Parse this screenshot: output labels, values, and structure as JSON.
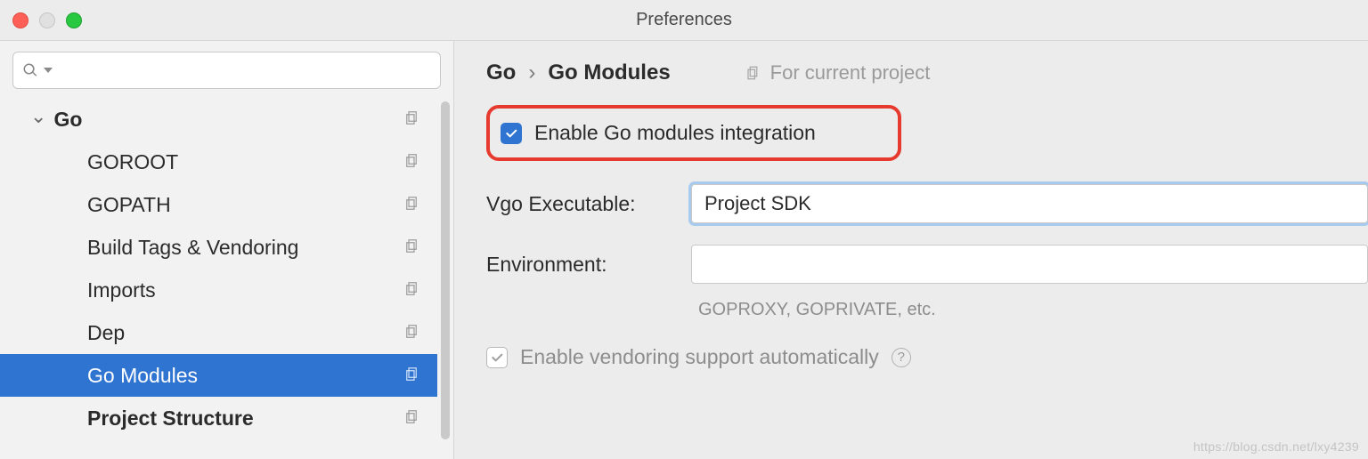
{
  "window": {
    "title": "Preferences"
  },
  "sidebar": {
    "search_placeholder": "",
    "items": [
      {
        "label": "Go",
        "kind": "root",
        "has_copy": true
      },
      {
        "label": "GOROOT",
        "kind": "child",
        "has_copy": true
      },
      {
        "label": "GOPATH",
        "kind": "child",
        "has_copy": true
      },
      {
        "label": "Build Tags & Vendoring",
        "kind": "child",
        "has_copy": true
      },
      {
        "label": "Imports",
        "kind": "child",
        "has_copy": true
      },
      {
        "label": "Dep",
        "kind": "child",
        "has_copy": true
      },
      {
        "label": "Go Modules",
        "kind": "child",
        "has_copy": true,
        "selected": true
      },
      {
        "label": "Project Structure",
        "kind": "bold",
        "has_copy": true
      }
    ]
  },
  "breadcrumbs": {
    "parts": [
      "Go",
      "Go Modules"
    ],
    "for_current_project": "For current project"
  },
  "form": {
    "enable_modules_label": "Enable Go modules integration",
    "enable_modules_checked": true,
    "vgo_label": "Vgo Executable:",
    "vgo_value": "Project SDK",
    "env_label": "Environment:",
    "env_value": "",
    "env_hint": "GOPROXY, GOPRIVATE, etc.",
    "vendoring_label": "Enable vendoring support automatically",
    "vendoring_checked": true,
    "vendoring_disabled": true
  },
  "watermark": "https://blog.csdn.net/lxy4239"
}
